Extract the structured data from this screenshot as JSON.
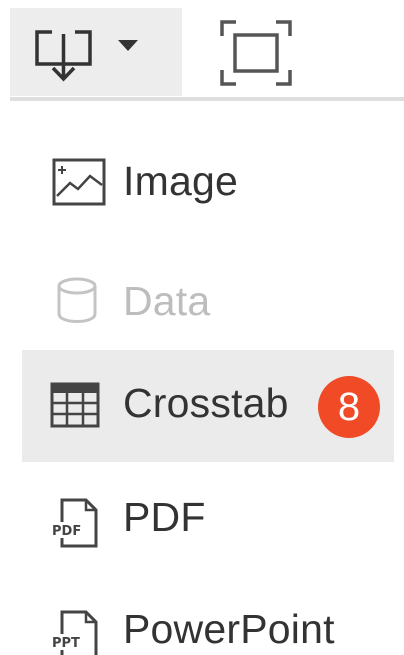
{
  "toolbar": {
    "download_icon": "download-icon",
    "caret_icon": "caret-down-icon",
    "fullscreen_icon": "fullscreen-icon"
  },
  "menu": {
    "items": [
      {
        "label": "Image",
        "icon": "image-icon",
        "enabled": true
      },
      {
        "label": "Data",
        "icon": "database-icon",
        "enabled": false
      },
      {
        "label": "Crosstab",
        "icon": "table-icon",
        "enabled": true,
        "selected": true
      },
      {
        "label": "PDF",
        "icon": "pdf-file-icon",
        "enabled": true
      },
      {
        "label": "PowerPoint",
        "icon": "ppt-file-icon",
        "enabled": true
      }
    ],
    "badge": "8"
  },
  "colors": {
    "text": "#333333",
    "disabled_text": "#bdbdbd",
    "selected_bg": "#ebebeb",
    "toolbar_button_bg": "#ededed",
    "badge": "#f04a26"
  }
}
